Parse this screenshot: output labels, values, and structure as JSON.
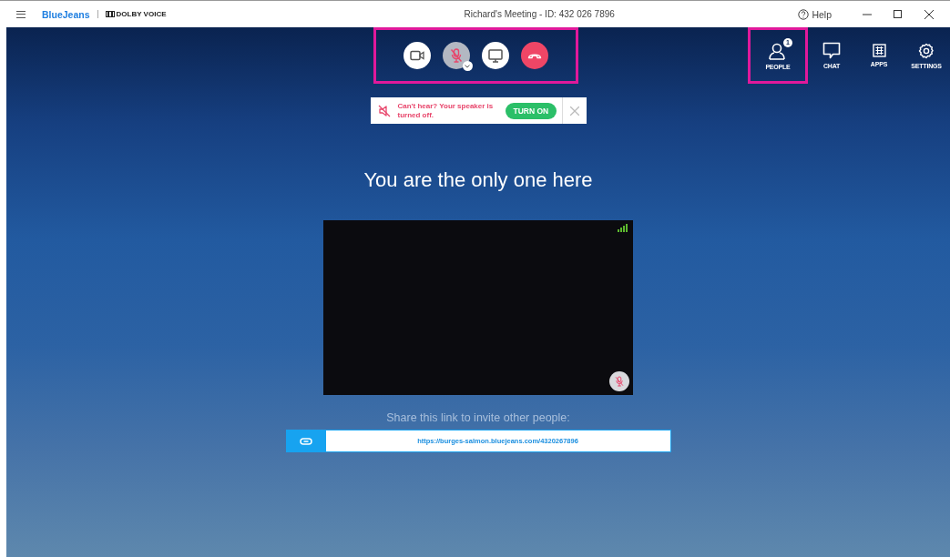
{
  "window": {
    "title": "Richard's Meeting - ID: 432 026 7896",
    "brand": "BlueJeans",
    "partner": "DOLBY VOICE",
    "help": "Help"
  },
  "controls": {
    "highlighted": true,
    "buttons": [
      {
        "kind": "video",
        "muted": false
      },
      {
        "kind": "mic",
        "muted": true
      },
      {
        "kind": "screen",
        "muted": false
      },
      {
        "kind": "hangup",
        "muted": false
      }
    ]
  },
  "nav": [
    {
      "kind": "people",
      "label": "PEOPLE",
      "badge": "1",
      "highlighted": true
    },
    {
      "kind": "chat",
      "label": "CHAT",
      "highlighted": false
    },
    {
      "kind": "apps",
      "label": "APPS",
      "highlighted": false
    },
    {
      "kind": "settings",
      "label": "SETTINGS",
      "highlighted": false
    }
  ],
  "notice": {
    "text": "Can't hear? Your speaker is turned off.",
    "action": "TURN ON"
  },
  "heading": "You are the only one here",
  "video": {
    "muted": true
  },
  "share": {
    "label": "Share this link to invite other people:",
    "link": "https://burges-salmon.bluejeans.com/4320267896"
  }
}
